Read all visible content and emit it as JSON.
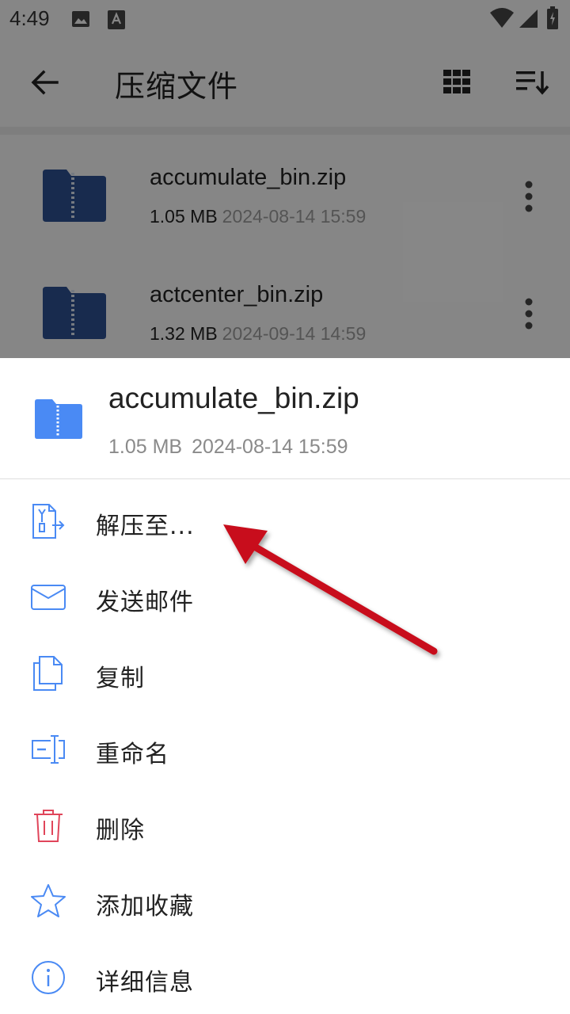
{
  "status_bar": {
    "time": "4:49"
  },
  "app_bar": {
    "title": "压缩文件"
  },
  "colors": {
    "accent": "#4a8af4",
    "folder_dark": "#2d4f8f",
    "danger": "#e0455a",
    "arrow": "#c8101a"
  },
  "file_list": [
    {
      "name": "accumulate_bin.zip",
      "size": "1.05 MB",
      "date": "2024-08-14 15:59"
    },
    {
      "name": "actcenter_bin.zip",
      "size": "1.32 MB",
      "date": "2024-09-14 14:59"
    }
  ],
  "sheet": {
    "file_name": "accumulate_bin.zip",
    "size": "1.05 MB",
    "date": "2024-08-14 15:59",
    "actions": [
      {
        "label": "解压至...",
        "icon": "extract-icon"
      },
      {
        "label": "发送邮件",
        "icon": "mail-icon"
      },
      {
        "label": "复制",
        "icon": "copy-icon"
      },
      {
        "label": "重命名",
        "icon": "rename-icon"
      },
      {
        "label": "删除",
        "icon": "trash-icon"
      },
      {
        "label": "添加收藏",
        "icon": "star-icon"
      },
      {
        "label": "详细信息",
        "icon": "info-icon"
      }
    ]
  }
}
